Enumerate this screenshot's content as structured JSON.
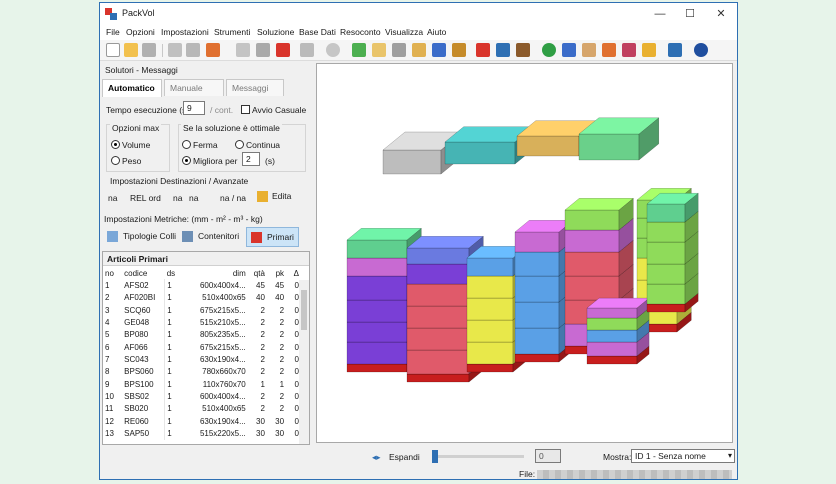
{
  "window": {
    "title": "PackVol"
  },
  "window_controls": {
    "minimize": "—",
    "maximize": "☐",
    "close": "✕"
  },
  "menu": [
    "File",
    "Opzioni",
    "Impostazioni",
    "Strumenti",
    "Soluzione",
    "Base Dati",
    "Resoconto",
    "Visualizza",
    "Aiuto"
  ],
  "left": {
    "header": "Solutori - Messaggi",
    "tabs": [
      "Automatico",
      "Manuale",
      "Messaggi"
    ],
    "tempo_label": "Tempo esecuzione (s)",
    "tempo_value": "9",
    "tempo_suffix": "/ cont.",
    "avvio_casuale": "Avvio Casuale",
    "opzioni_max_title": "Opzioni max",
    "opt_volume": "Volume",
    "opt_peso": "Peso",
    "se_soluzione_title": "Se la soluzione è ottimale",
    "opt_ferma": "Ferma",
    "opt_continua": "Continua",
    "opt_migliora": "Migliora per",
    "migliora_value": "2",
    "migliora_unit": "(s)",
    "dest_title": "Impostazioni Destinazioni / Avanzate",
    "dest_values": [
      "na",
      "REL ord",
      "na",
      "na",
      "na / na"
    ],
    "edita": "Edita",
    "metriche": "Impostazioni Metriche: (mm - m² - m³ - kg)",
    "btn_tipologie": "Tipologie Colli",
    "btn_contenitori": "Contenitori",
    "btn_primari": "Primari",
    "articoli_title": "Articoli Primari"
  },
  "table": {
    "columns": [
      "no",
      "codice",
      "ds",
      "dim",
      "qtà",
      "pk",
      "Δ"
    ],
    "rows": [
      [
        "1",
        "AFS02",
        "1",
        "600x400x4...",
        "45",
        "45",
        "0"
      ],
      [
        "2",
        "AF020BI",
        "1",
        "510x400x65",
        "40",
        "40",
        "0"
      ],
      [
        "3",
        "SCQ60",
        "1",
        "675x215x5...",
        "2",
        "2",
        "0"
      ],
      [
        "4",
        "GE048",
        "1",
        "515x210x5...",
        "2",
        "2",
        "0"
      ],
      [
        "5",
        "BP080",
        "1",
        "805x235x5...",
        "2",
        "2",
        "0"
      ],
      [
        "6",
        "AF066",
        "1",
        "675x215x5...",
        "2",
        "2",
        "0"
      ],
      [
        "7",
        "SC043",
        "1",
        "630x190x4...",
        "2",
        "2",
        "0"
      ],
      [
        "8",
        "BPS060",
        "1",
        "780x660x70",
        "2",
        "2",
        "0"
      ],
      [
        "9",
        "BPS100",
        "1",
        "110x760x70",
        "1",
        "1",
        "0"
      ],
      [
        "10",
        "SBS02",
        "1",
        "600x400x4...",
        "2",
        "2",
        "0"
      ],
      [
        "11",
        "SB020",
        "1",
        "510x400x65",
        "2",
        "2",
        "0"
      ],
      [
        "12",
        "RE060",
        "1",
        "630x190x4...",
        "30",
        "30",
        "0"
      ],
      [
        "13",
        "SAP50",
        "1",
        "515x220x5...",
        "30",
        "30",
        "0"
      ]
    ]
  },
  "status": {
    "espandi": "Espandi",
    "slider_value": "0",
    "mostra_label": "Mostra:",
    "mostra_value": "ID 1 - Senza nome",
    "file_label": "File:"
  },
  "colors": {
    "accent": "#2e6fb3",
    "pallet": "#c81e1e",
    "selected_button": "#cce4f7"
  },
  "icons": [
    "app-icon",
    "new-file-icon",
    "open-folder-icon",
    "save-icon",
    "settings-icon",
    "refresh-icon",
    "grid-icon",
    "hand-icon",
    "help-icon"
  ]
}
